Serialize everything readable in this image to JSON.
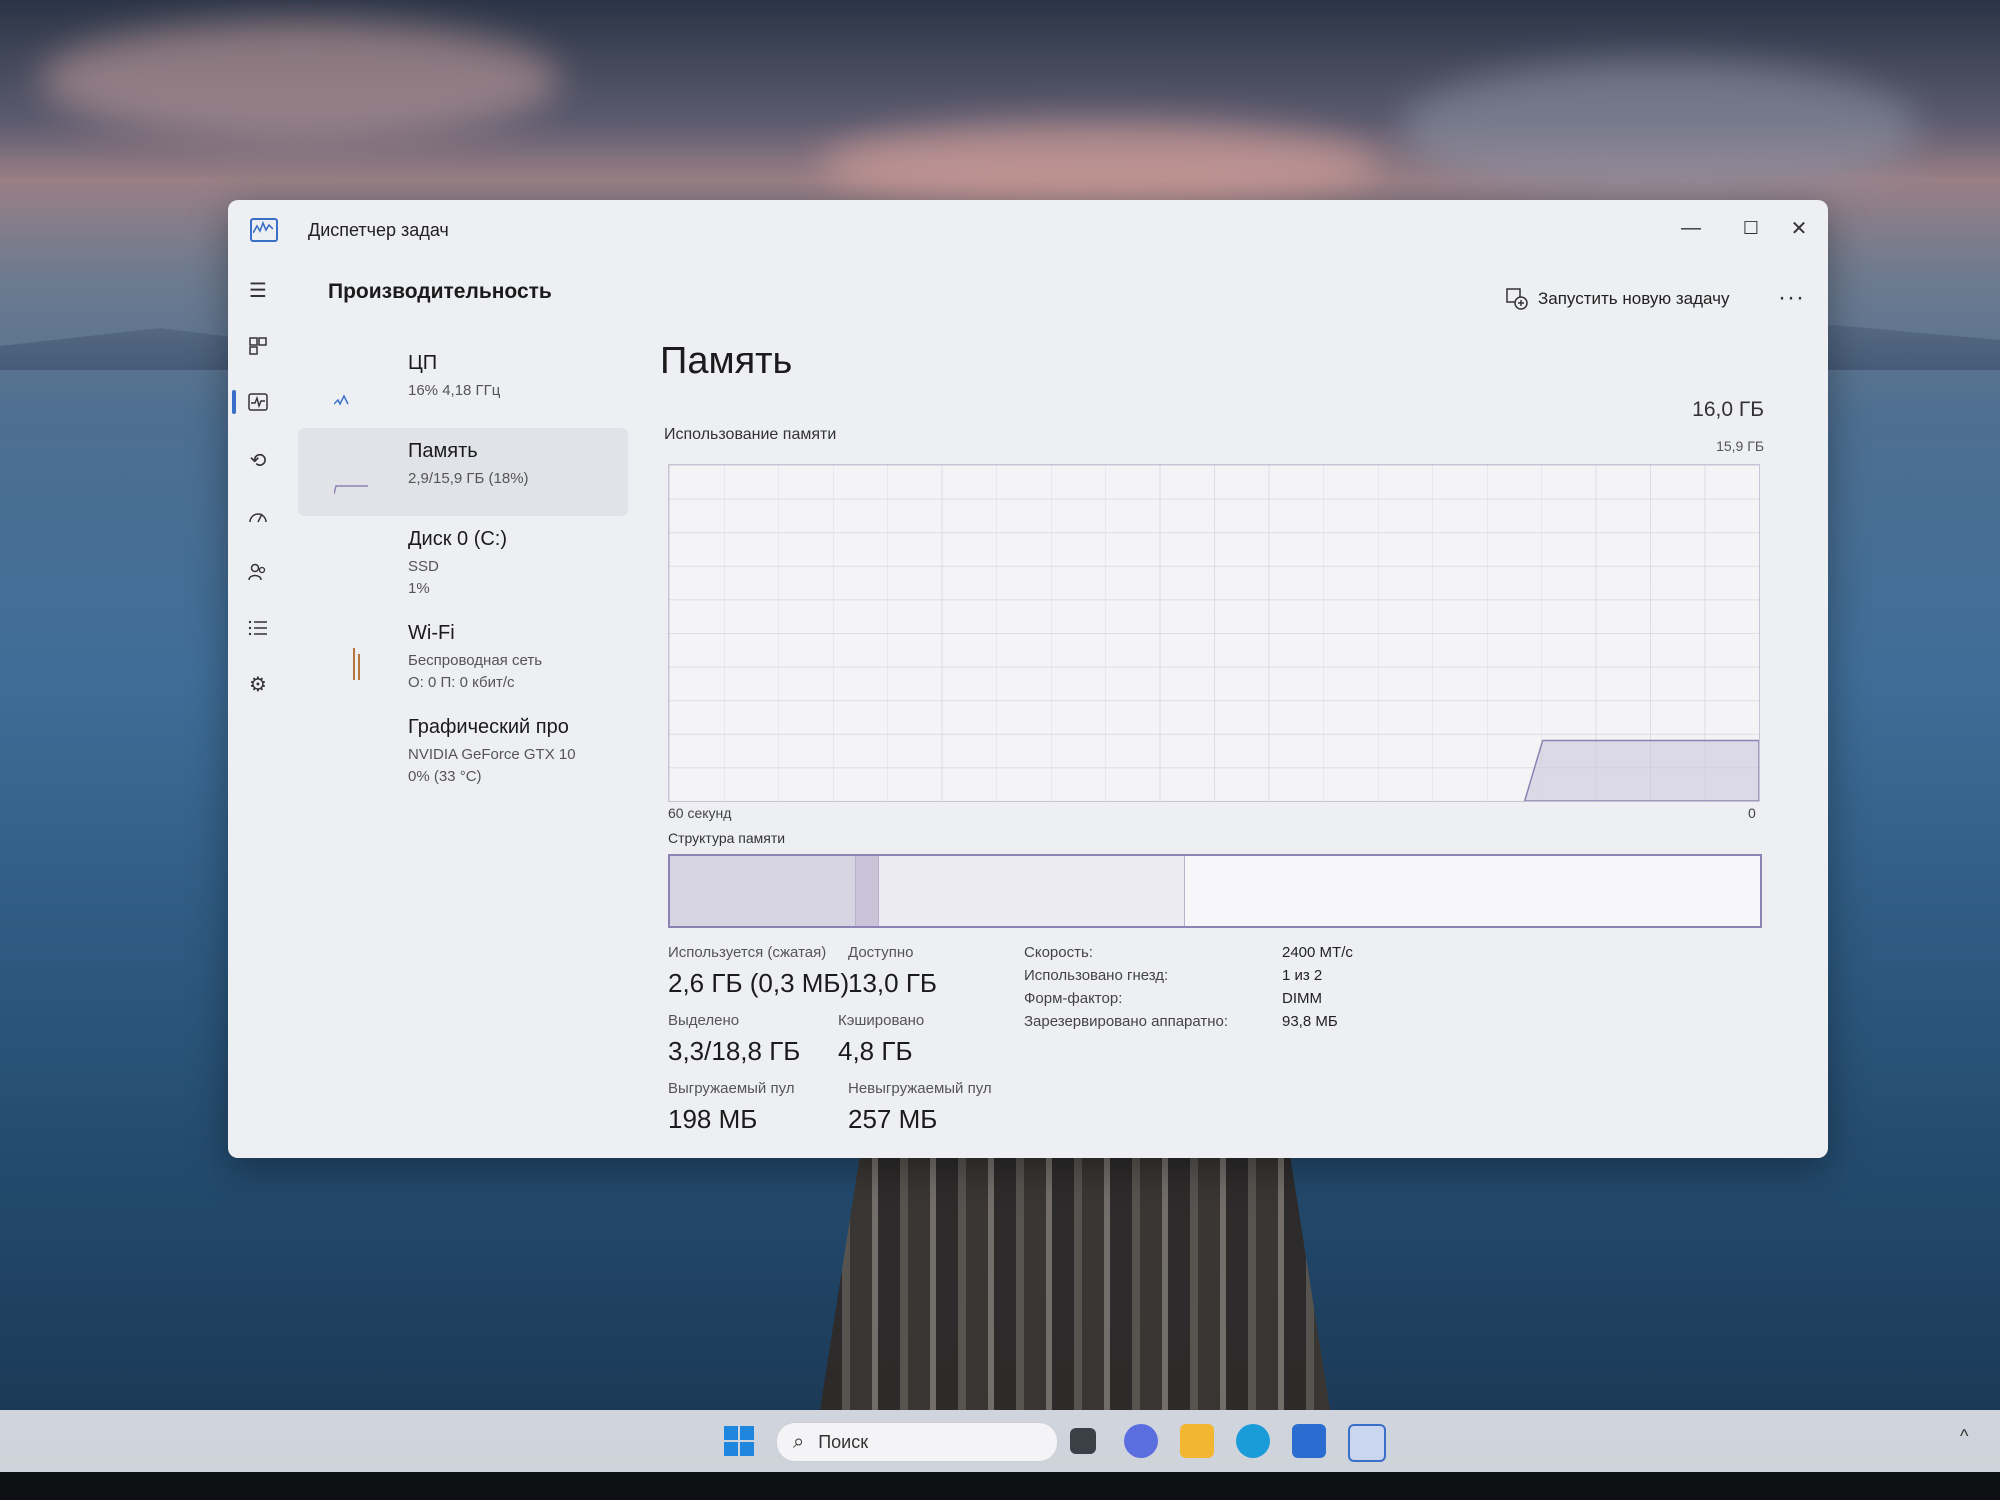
{
  "window": {
    "title": "Диспетчер задач",
    "minimize": "—",
    "maximize": "☐",
    "close": "✕"
  },
  "header": {
    "page_title": "Производительность",
    "new_task_label": "Запустить новую задачу",
    "more_label": "···"
  },
  "perf_list": [
    {
      "name": "ЦП",
      "sub1": "16% 4,18 ГГц",
      "sub2": "",
      "sub3": ""
    },
    {
      "name": "Память",
      "sub1": "2,9/15,9 ГБ (18%)",
      "sub2": "",
      "sub3": ""
    },
    {
      "name": "Диск 0 (C:)",
      "sub1": "SSD",
      "sub2": "1%",
      "sub3": ""
    },
    {
      "name": "Wi-Fi",
      "sub1": "Беспроводная сеть",
      "sub2": "О: 0 П: 0 кбит/с",
      "sub3": ""
    },
    {
      "name": "Графический про",
      "sub1": "NVIDIA GeForce GTX 10",
      "sub2": "0% (33 °C)",
      "sub3": ""
    }
  ],
  "main": {
    "title": "Память",
    "total": "16,0 ГБ",
    "usage_label": "Использование памяти",
    "usage_max": "15,9 ГБ",
    "graph_left": "60 секунд",
    "graph_right": "0",
    "structure_label": "Структура памяти"
  },
  "stats": {
    "in_use_label": "Используется (сжатая)",
    "in_use_value": "2,6 ГБ (0,3 МБ)",
    "available_label": "Доступно",
    "available_value": "13,0 ГБ",
    "committed_label": "Выделено",
    "committed_value": "3,3/18,8 ГБ",
    "cached_label": "Кэшировано",
    "cached_value": "4,8 ГБ",
    "paged_label": "Выгружаемый пул",
    "paged_value": "198 МБ",
    "nonpaged_label": "Невыгружаемый пул",
    "nonpaged_value": "257 МБ"
  },
  "specs": [
    {
      "key": "Скорость:",
      "value": "2400 МТ/с"
    },
    {
      "key": "Использовано гнезд:",
      "value": "1 из 2"
    },
    {
      "key": "Форм-фактор:",
      "value": "DIMM"
    },
    {
      "key": "Зарезервировано аппаратно:",
      "value": "93,8 МБ"
    }
  ],
  "memory_structure": {
    "used_fraction": 0.17,
    "modified_fraction": 0.02,
    "standby_fraction": 0.28
  },
  "memory_history": {
    "usage_percent": 18
  },
  "taskbar": {
    "search_placeholder": "Поиск",
    "tray_chevron": "^"
  },
  "colors": {
    "accent": "#3a6fc9",
    "memory_purple": "#8d82b4"
  }
}
